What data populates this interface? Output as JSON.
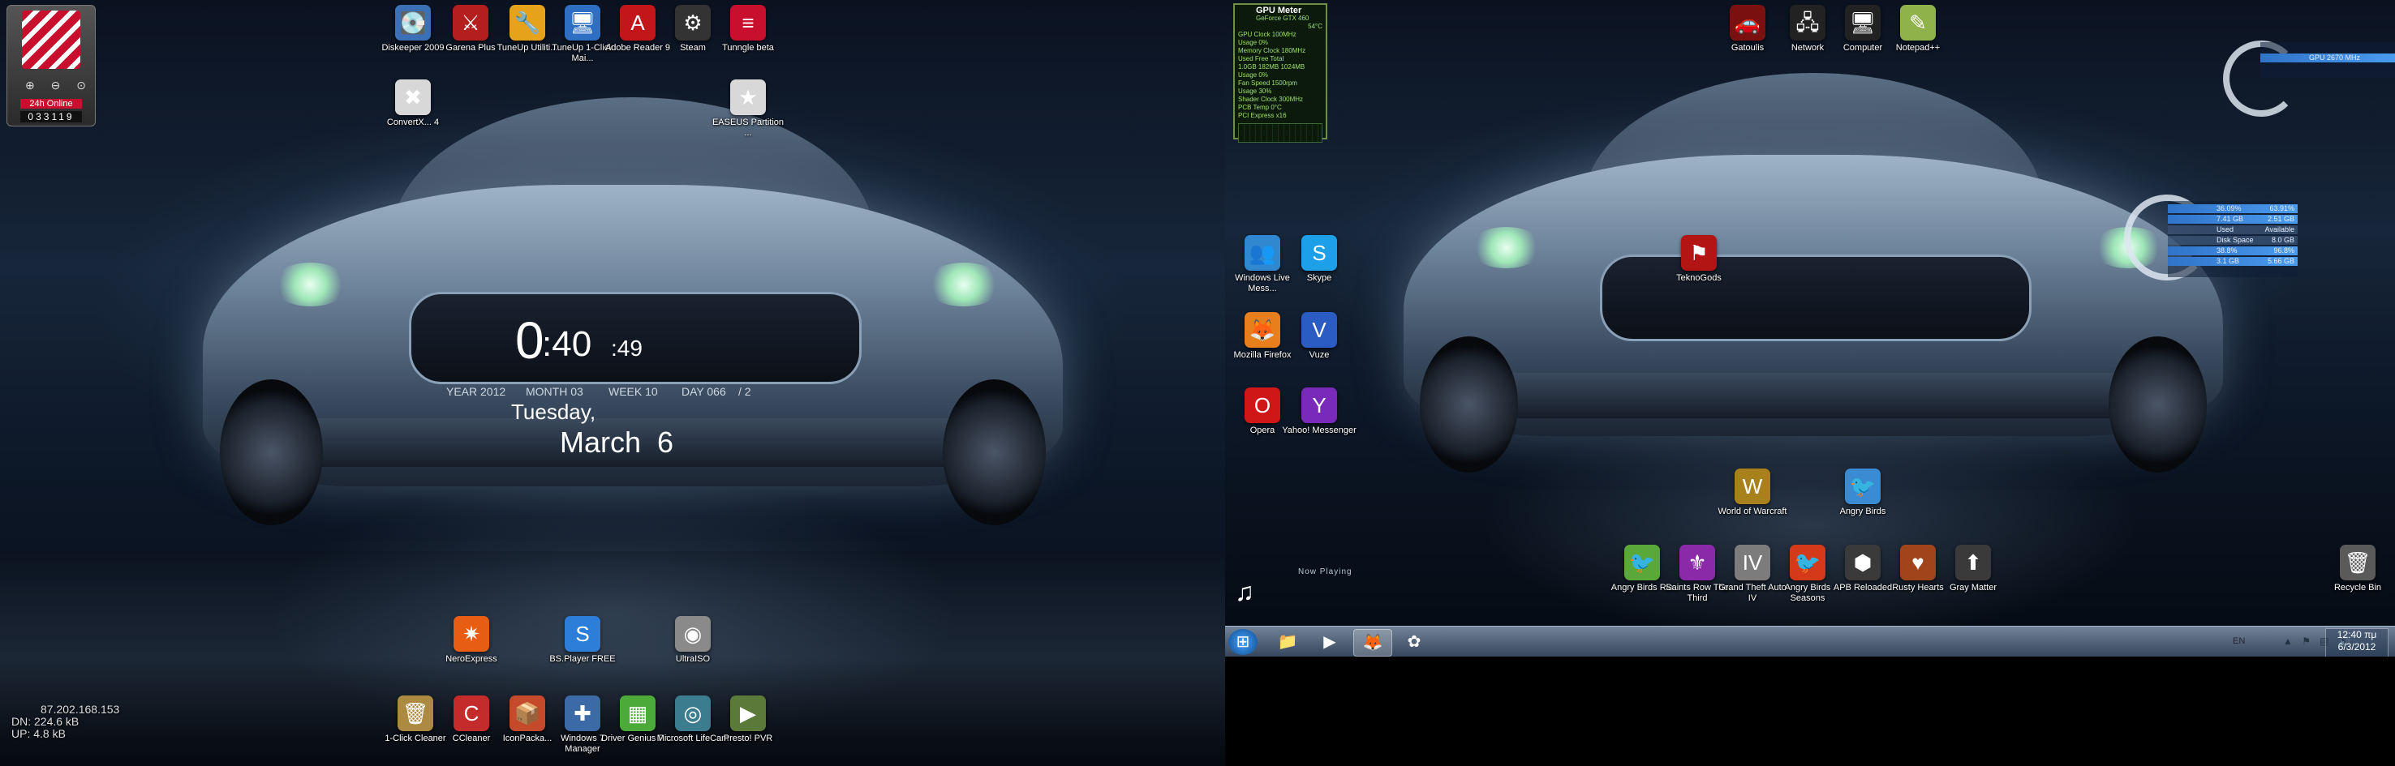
{
  "left_monitor": {
    "widget": {
      "online_label": "24h Online",
      "online_count": "033119",
      "controls": "⊕ ⊖ ⊙"
    },
    "clock": {
      "hour": "0",
      "minute": ":40",
      "second": ":49",
      "year": "YEAR 2012",
      "month_num": "MONTH 03",
      "week": "WEEK 10",
      "day_num": "DAY 066",
      "day_div": "/ 2",
      "weekday": "Tuesday,",
      "month": "March",
      "date": "6"
    },
    "net": {
      "ip": "87.202.168.153",
      "dn": "DN:  224.6 kB",
      "up": "UP:      4.8 kB"
    },
    "icons": [
      {
        "label": "Diskeeper 2009",
        "glyph": "💽",
        "color": "#3b6fb6"
      },
      {
        "label": "Garena Plus",
        "glyph": "⚔",
        "color": "#b51e1e"
      },
      {
        "label": "TuneUp Utiliti...",
        "glyph": "🔧",
        "color": "#e6a21a"
      },
      {
        "label": "TuneUp 1-Click Mai...",
        "glyph": "🖥",
        "color": "#2e6fc4"
      },
      {
        "label": "Adobe Reader 9",
        "glyph": "A",
        "color": "#c2161b"
      },
      {
        "label": "Steam",
        "glyph": "⚙",
        "color": "#333"
      },
      {
        "label": "Tunngle beta",
        "glyph": "≡",
        "color": "#c8102e"
      },
      {
        "label": "ConvertX... 4",
        "glyph": "✖",
        "color": "#d8d8d8"
      },
      {
        "label": "EASEUS Partition ...",
        "glyph": "★",
        "color": "#d8d8d8"
      },
      {
        "label": "NeroExpress",
        "glyph": "✷",
        "color": "#e85d14"
      },
      {
        "label": "BS.Player FREE",
        "glyph": "S",
        "color": "#2d7ed8"
      },
      {
        "label": "UltraISO",
        "glyph": "◉",
        "color": "#8a8a8a"
      },
      {
        "label": "1-Click Cleaner",
        "glyph": "🗑",
        "color": "#ad8a42"
      },
      {
        "label": "CCleaner",
        "glyph": "C",
        "color": "#c42b2b"
      },
      {
        "label": "IconPacka...",
        "glyph": "📦",
        "color": "#c44a2b"
      },
      {
        "label": "Windows 7 Manager",
        "glyph": "✚",
        "color": "#3c6aa6"
      },
      {
        "label": "Driver Genius Pr...",
        "glyph": "▦",
        "color": "#4caa38"
      },
      {
        "label": "Microsoft LifeCam",
        "glyph": "◎",
        "color": "#3b7c8e"
      },
      {
        "label": "Presto! PVR",
        "glyph": "▶",
        "color": "#5b7a3a"
      }
    ]
  },
  "right_monitor": {
    "gpu_meter": {
      "title": "GPU Meter",
      "model": "GeForce GTX 460",
      "temp": "54°C",
      "lines": [
        "GPU Clock 100MHz",
        "Usage 0%",
        "Memory Clock 180MHz",
        "Used  Free  Total",
        "1.0GB  182MB  1024MB",
        "Usage 0%",
        "Fan Speed 1500rpm",
        "Usage 30%",
        "Shader Clock 300MHz",
        "PCB Temp 0°C",
        "PCI Express x16"
      ]
    },
    "cpu_widget": {
      "label": "GPU 2670 MHz"
    },
    "drive_widget": {
      "rows": [
        {
          "left": "36.09%",
          "right": "63.91%"
        },
        {
          "left": "7.41 GB",
          "right": "2.51 GB"
        },
        {
          "left": "Used",
          "right": "Available"
        },
        {
          "left": "Disk Space",
          "right": "8.0 GB"
        },
        {
          "left": "38.8%",
          "right": "96.8%"
        },
        {
          "left": "3.1 GB",
          "right": "5.66 GB"
        }
      ]
    },
    "icons": [
      {
        "label": "Gatoulis",
        "glyph": "🚗",
        "color": "#7a1010"
      },
      {
        "label": "Network",
        "glyph": "🖧",
        "color": "#222"
      },
      {
        "label": "Computer",
        "glyph": "🖥",
        "color": "#222"
      },
      {
        "label": "Notepad++",
        "glyph": "✎",
        "color": "#8fb34a"
      },
      {
        "label": "Windows Live Mess...",
        "glyph": "👥",
        "color": "#2f88d0"
      },
      {
        "label": "Skype",
        "glyph": "S",
        "color": "#1ea0e8"
      },
      {
        "label": "Mozilla Firefox",
        "glyph": "🦊",
        "color": "#e67f1c"
      },
      {
        "label": "Vuze",
        "glyph": "V",
        "color": "#2b5cc4"
      },
      {
        "label": "Opera",
        "glyph": "O",
        "color": "#d01717"
      },
      {
        "label": "Yahoo! Messenger",
        "glyph": "Y",
        "color": "#7a2ab8"
      },
      {
        "label": "TeknoGods",
        "glyph": "⚑",
        "color": "#b31414"
      },
      {
        "label": "World of Warcraft",
        "glyph": "W",
        "color": "#a8801c"
      },
      {
        "label": "Angry Birds",
        "glyph": "🐦",
        "color": "#3a8bd1"
      },
      {
        "label": "Angry Birds Rio",
        "glyph": "🐦",
        "color": "#5aa83a"
      },
      {
        "label": "Saints Row The Third",
        "glyph": "⚜",
        "color": "#8a2aa8"
      },
      {
        "label": "Grand Theft Auto IV",
        "glyph": "IV",
        "color": "#7c7c7c"
      },
      {
        "label": "Angry Birds Seasons",
        "glyph": "🐦",
        "color": "#d43a1a"
      },
      {
        "label": "APB Reloaded",
        "glyph": "⬢",
        "color": "#3a3a3a"
      },
      {
        "label": "Rusty Hearts",
        "glyph": "♥",
        "color": "#a0441c"
      },
      {
        "label": "Gray Matter",
        "glyph": "⬆",
        "color": "#3a3a3a"
      },
      {
        "label": "Recycle Bin",
        "glyph": "🗑",
        "color": "#5a5a5a"
      }
    ],
    "now_playing": "Now Playing",
    "taskbar": {
      "buttons": [
        {
          "name": "start",
          "glyph": "⊞"
        },
        {
          "name": "explorer",
          "glyph": "📁"
        },
        {
          "name": "media-player",
          "glyph": "▶"
        },
        {
          "name": "firefox",
          "glyph": "🦊"
        },
        {
          "name": "app",
          "glyph": "✿"
        }
      ],
      "lang": "EN",
      "tray_icons": "▲ ⚑ ▤ 🔊",
      "time": "12:40 πμ",
      "date": "6/3/2012"
    }
  }
}
